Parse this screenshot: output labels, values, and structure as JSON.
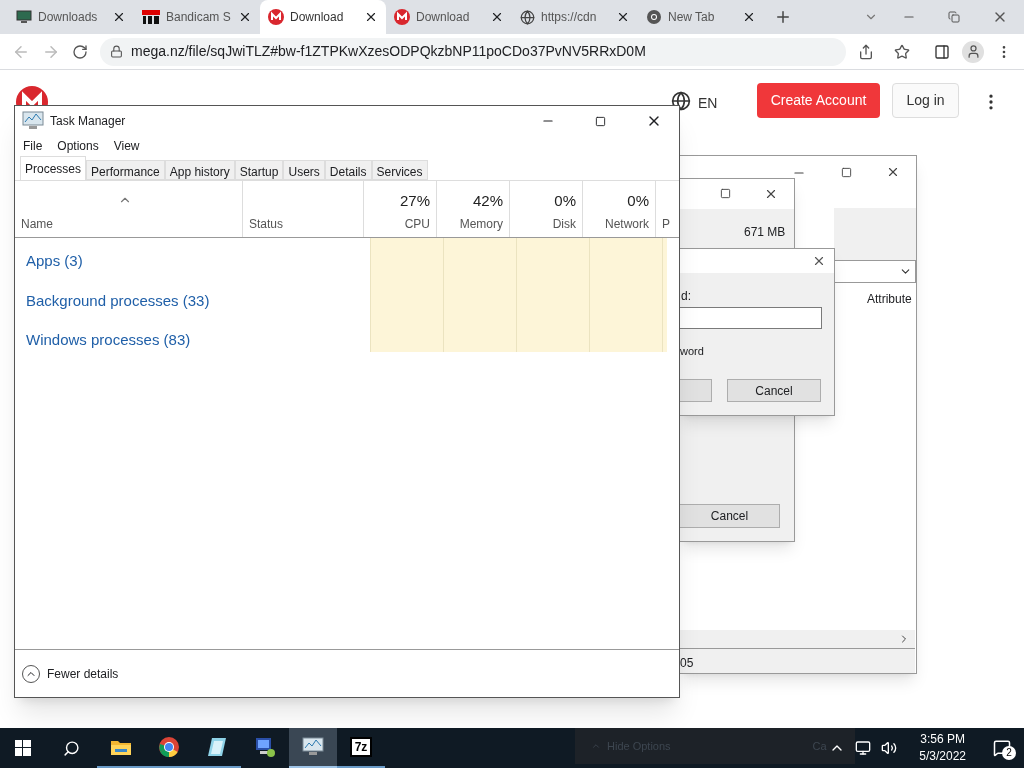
{
  "browser": {
    "tabs": [
      {
        "title": "Downloads",
        "kind": "monitor",
        "selected": false
      },
      {
        "title": "Bandicam S",
        "kind": "fps",
        "selected": false
      },
      {
        "title": "Download",
        "kind": "mega",
        "selected": true
      },
      {
        "title": "Download",
        "kind": "mega",
        "selected": false
      },
      {
        "title": "https://cdn",
        "kind": "globe",
        "selected": false
      },
      {
        "title": "New Tab",
        "kind": "chrome",
        "selected": false
      }
    ],
    "url": "mega.nz/file/sqJwiTLZ#bw-f1ZTPKwXzesODPQkzbNP11poCDo37PvNV5RRxD0M"
  },
  "page": {
    "language": "EN",
    "create_account": "Create Account",
    "login": "Log in"
  },
  "back_window": {
    "column_header": "Attribute",
    "status_text": "05"
  },
  "middle_window": {
    "size": "671 MB",
    "button": "Cancel"
  },
  "dialog": {
    "label": "d:",
    "checkbox_label": "word",
    "button": "Cancel"
  },
  "task_manager": {
    "title": "Task Manager",
    "menu": [
      "File",
      "Options",
      "View"
    ],
    "tabs": [
      {
        "label": "Processes",
        "selected": true
      },
      {
        "label": "Performance",
        "selected": false
      },
      {
        "label": "App history",
        "selected": false
      },
      {
        "label": "Startup",
        "selected": false
      },
      {
        "label": "Users",
        "selected": false
      },
      {
        "label": "Details",
        "selected": false
      },
      {
        "label": "Services",
        "selected": false
      }
    ],
    "columns": [
      {
        "name": "Name",
        "kind": "text"
      },
      {
        "name": "Status",
        "kind": "text"
      },
      {
        "name": "CPU",
        "value": "27%",
        "kind": "metric"
      },
      {
        "name": "Memory",
        "value": "42%",
        "kind": "metric"
      },
      {
        "name": "Disk",
        "value": "0%",
        "kind": "metric"
      },
      {
        "name": "Network",
        "value": "0%",
        "kind": "metric"
      },
      {
        "name": "P",
        "kind": "cut"
      }
    ],
    "groups": [
      "Apps (3)",
      "Background processes (33)",
      "Windows processes (83)"
    ],
    "footer": "Fewer details"
  },
  "taskbar": {
    "apps": [
      {
        "kind": "explorer",
        "running": true,
        "selected": false
      },
      {
        "kind": "chrome",
        "running": true,
        "selected": false
      },
      {
        "kind": "notepad",
        "running": true,
        "selected": false
      },
      {
        "kind": "remote",
        "running": false,
        "selected": false
      },
      {
        "kind": "taskmgr",
        "running": true,
        "selected": true
      },
      {
        "kind": "sevenzip",
        "label": "7z",
        "running": true,
        "selected": false
      }
    ],
    "overlay": {
      "text": "Hide Options",
      "button": "Ca"
    },
    "time": "3:56 PM",
    "date": "5/3/2022",
    "notifications": "2"
  }
}
